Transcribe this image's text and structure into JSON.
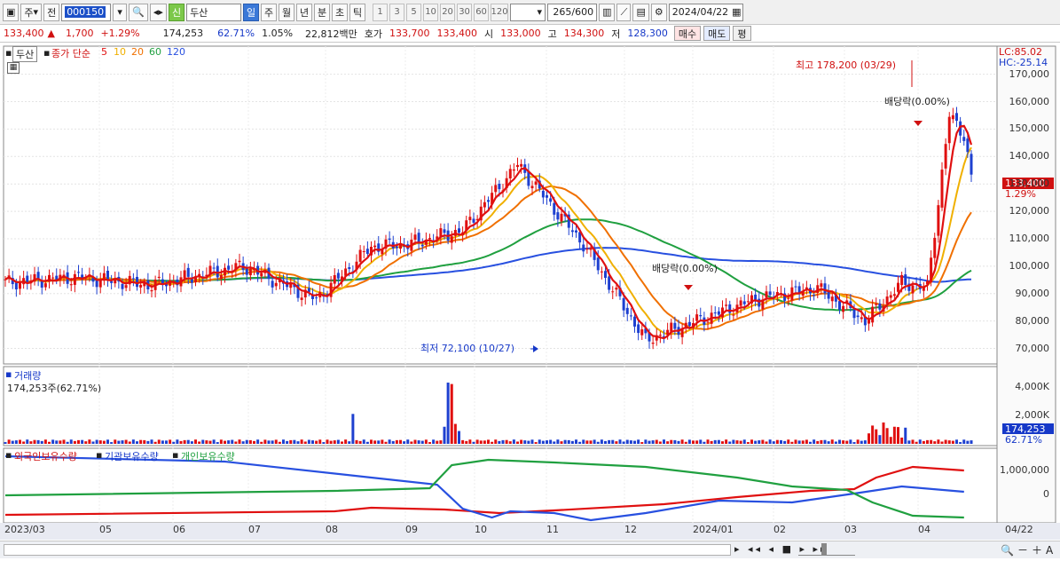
{
  "toolbar": {
    "market": "주",
    "all": "전",
    "code": "000150",
    "name_badge": "신",
    "name": "두산",
    "periods": [
      "일",
      "주",
      "월",
      "년",
      "분",
      "초",
      "틱"
    ],
    "active_period": "일",
    "intervals": [
      "1",
      "3",
      "5",
      "10",
      "20",
      "30",
      "60",
      "120"
    ],
    "count": "265",
    "count_total": "/600",
    "date": "2024/04/22"
  },
  "quote": {
    "price": "133,400",
    "change": "1,700",
    "change_pct": "+1.29%",
    "volume": "174,253",
    "volume_pct": "62.71%",
    "turnover_pct": "1.05%",
    "amount": "22,812백만",
    "ask_label": "호가",
    "ask": "133,700",
    "bid": "133,400",
    "open_label": "시",
    "open": "133,000",
    "high_label": "고",
    "high": "134,300",
    "low_label": "저",
    "low": "128,300",
    "buy": "매수",
    "sell": "매도",
    "eval": "평"
  },
  "price_panel": {
    "name": "두산",
    "ma_title": "종가 단순",
    "ma_periods": [
      "5",
      "10",
      "20",
      "60",
      "120"
    ],
    "ma_colors": [
      "#e01010",
      "#f0b000",
      "#f07000",
      "#20a040",
      "#2850e0"
    ],
    "lc": "LC:85.02",
    "hc": "HC:-25.14",
    "high_annot": "최고 178,200 (03/29)",
    "low_annot": "최저 72,100 (10/27)",
    "div1": "배당락(0.00%)",
    "div2": "배당락(0.00%)",
    "current_price": "133,400",
    "current_pct": "1.29%"
  },
  "volume_panel": {
    "title": "거래량",
    "value": "174,253주(62.71%)",
    "current": "174,253",
    "current_pct": "62.71%"
  },
  "holding_panel": {
    "series_labels": [
      "외국인보유수량",
      "기관보유수량",
      "개인보유수량"
    ],
    "colors": [
      "#e01010",
      "#2850e0",
      "#20a040"
    ]
  },
  "xaxis": {
    "labels": [
      "2023/03",
      "05",
      "06",
      "07",
      "08",
      "09",
      "10",
      "11",
      "12",
      "2024/01",
      "02",
      "03",
      "04"
    ],
    "right_label": "04/22"
  },
  "chart_data": [
    {
      "type": "candlestick",
      "title": "두산",
      "yticks": [
        "170,000",
        "160,000",
        "150,000",
        "140,000",
        "130,000",
        "120,000",
        "110,000",
        "100,000",
        "90,000",
        "80,000",
        "70,000"
      ],
      "ylim": [
        65000,
        177000
      ],
      "close_series_approx": [
        {
          "x": "2023/03",
          "v": 94000
        },
        {
          "x": "04",
          "v": 96000
        },
        {
          "x": "05",
          "v": 93000
        },
        {
          "x": "06",
          "v": 100000
        },
        {
          "x": "07",
          "v": 88000
        },
        {
          "x": "08",
          "v": 107000
        },
        {
          "x": "08-late",
          "v": 108000
        },
        {
          "x": "09",
          "v": 113000
        },
        {
          "x": "09-mid",
          "v": 137000
        },
        {
          "x": "10",
          "v": 108000
        },
        {
          "x": "10-late",
          "v": 73000
        },
        {
          "x": "11",
          "v": 78000
        },
        {
          "x": "12",
          "v": 88000
        },
        {
          "x": "2024/01",
          "v": 92000
        },
        {
          "x": "01-late",
          "v": 80000
        },
        {
          "x": "02",
          "v": 94000
        },
        {
          "x": "03",
          "v": 92000
        },
        {
          "x": "03-mid",
          "v": 155000
        },
        {
          "x": "04",
          "v": 148000
        },
        {
          "x": "04/22",
          "v": 133400
        }
      ]
    },
    {
      "type": "bar",
      "title": "거래량",
      "yticks": [
        "4,000K",
        "2,000K"
      ],
      "ylim": [
        0,
        4800
      ]
    },
    {
      "type": "line",
      "yticks": [
        "1,000,000",
        "0"
      ],
      "series": [
        {
          "name": "외국인보유수량"
        },
        {
          "name": "기관보유수량"
        },
        {
          "name": "개인보유수량"
        }
      ]
    }
  ]
}
